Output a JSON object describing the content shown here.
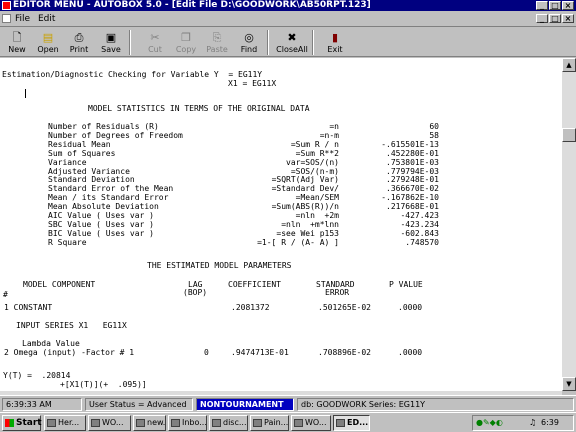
{
  "window": {
    "title": "EDITOR MENU - AUTOBOX 5.0 - [Edit File D:\\GOODWORK\\AB50RPT.123]",
    "controls": {
      "minimize": "_",
      "maximize": "□",
      "close": "×"
    }
  },
  "menu": {
    "items": [
      "File",
      "Edit"
    ],
    "doc_controls": {
      "minimize": "_",
      "restore": "□",
      "close": "×"
    }
  },
  "toolbar": {
    "buttons": [
      {
        "label": "New",
        "icon": "new-file-icon",
        "enabled": true
      },
      {
        "label": "Open",
        "icon": "open-folder-icon",
        "enabled": true
      },
      {
        "label": "Print",
        "icon": "printer-icon",
        "enabled": true
      },
      {
        "label": "Save",
        "icon": "save-disk-icon",
        "enabled": true
      },
      {
        "label": "Cut",
        "icon": "scissors-icon",
        "enabled": false
      },
      {
        "label": "Copy",
        "icon": "copy-icon",
        "enabled": false
      },
      {
        "label": "Paste",
        "icon": "paste-icon",
        "enabled": false
      },
      {
        "label": "Find",
        "icon": "binoculars-icon",
        "enabled": true
      },
      {
        "label": "CloseAll",
        "icon": "close-all-icon",
        "enabled": true
      },
      {
        "label": "Exit",
        "icon": "exit-door-icon",
        "enabled": true
      }
    ]
  },
  "report": {
    "header_line": "Estimation/Diagnostic Checking for Variable Y  = EG11Y",
    "header_line2": "X1 = EG11X",
    "stats_title": "MODEL STATISTICS IN TERMS OF THE ORIGINAL DATA",
    "stats": [
      {
        "name": "Number of Residuals (R)",
        "formula": "=n",
        "value": "60"
      },
      {
        "name": "Number of Degrees of Freedom",
        "formula": "=n-m",
        "value": "58"
      },
      {
        "name": "Residual Mean",
        "formula": "=Sum R / n",
        "value": "-.615501E-13"
      },
      {
        "name": "Sum of Squares",
        "formula": "=Sum R**2",
        "value": ".452280E-01"
      },
      {
        "name": "Variance",
        "formula": "var=SOS/(n)",
        "value": ".753801E-03"
      },
      {
        "name": "Adjusted Variance",
        "formula": "=SOS/(n-m)",
        "value": ".779794E-03"
      },
      {
        "name": "Standard Deviation",
        "formula": "=SQRT(Adj Var)",
        "value": ".279248E-01"
      },
      {
        "name": "Standard Error of the Mean",
        "formula": "=Standard Dev/",
        "value": ".366670E-02"
      },
      {
        "name": "Mean / its Standard Error",
        "formula": "=Mean/SEM",
        "value": "-.167862E-10"
      },
      {
        "name": "Mean Absolute Deviation",
        "formula": "=Sum(ABS(R))/n",
        "value": ".217668E-01"
      },
      {
        "name": "AIC Value ( Uses var )",
        "formula": "=nln  +2m",
        "value": "-427.423"
      },
      {
        "name": "SBC Value ( Uses var )",
        "formula": "=nln  +m*lnn",
        "value": "-423.234"
      },
      {
        "name": "BIC Value ( Uses var )",
        "formula": "=see Wei p153",
        "value": "-602.843"
      },
      {
        "name": "R Square",
        "formula": "=1-[ R / (A- A) ]",
        "value": ".748570"
      }
    ],
    "params_title": "THE ESTIMATED MODEL PARAMETERS",
    "params_header": {
      "component": "MODEL COMPONENT",
      "lag": "LAG",
      "lag2": "(BOP)",
      "coef": "COEFFICIENT",
      "se": "STANDARD",
      "se2": "ERROR",
      "p": "P VALUE",
      "hash": "#"
    },
    "param_rows": [
      {
        "label": "1 CONSTANT",
        "lag": "",
        "coef": ".2081372",
        "se": ".501265E-02",
        "p": ".0000"
      }
    ],
    "input_series": "INPUT SERIES X1   EG11X",
    "lambda": "Lambda Value",
    "param_rows2": [
      {
        "label": "2 Omega (input) -Factor # 1",
        "lag": "0",
        "coef": ".9474713E-01",
        "se": ".708896E-02",
        "p": ".0000"
      }
    ],
    "equation1": "Y(T) =  .20814",
    "equation2": "+[X1(T)](+  .095)]"
  },
  "status": {
    "time": "6:39:33 AM",
    "user_status": "User Status = Advanced",
    "mode": "NONTOURNAMENT",
    "db": "db: GOODWORK Series: EG11Y",
    "mode_color": "#0000c0"
  },
  "taskbar": {
    "start": "Start",
    "tasks": [
      "Her...",
      "WO...",
      "new...",
      "Inbo...",
      "disc...",
      "Pain...",
      "WO...",
      "ED..."
    ],
    "active_task": 7,
    "clock": "6:39 AM"
  }
}
